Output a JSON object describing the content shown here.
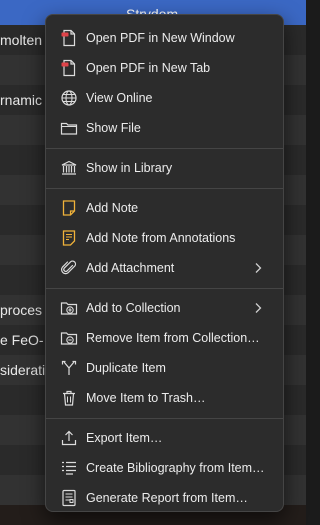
{
  "background": {
    "header_title": "Strydom",
    "rows": [
      "molten s",
      "",
      "rnamic t",
      "",
      "",
      "",
      "",
      "",
      "",
      "proces",
      "e FeO-",
      "siderati",
      "",
      "",
      "",
      "",
      ""
    ]
  },
  "menu": {
    "items": [
      {
        "label": "Open PDF in New Window",
        "icon": "pdf-window-icon"
      },
      {
        "label": "Open PDF in New Tab",
        "icon": "pdf-tab-icon"
      },
      {
        "label": "View Online",
        "icon": "globe-icon"
      },
      {
        "label": "Show File",
        "icon": "folder-icon"
      },
      {
        "label": "Show in Library",
        "icon": "library-icon"
      },
      {
        "label": "Add Note",
        "icon": "note-icon"
      },
      {
        "label": "Add Note from Annotations",
        "icon": "note-annotations-icon"
      },
      {
        "label": "Add Attachment",
        "icon": "paperclip-icon",
        "submenu": true
      },
      {
        "label": "Add to Collection",
        "icon": "add-collection-icon",
        "submenu": true
      },
      {
        "label": "Remove Item from Collection…",
        "icon": "remove-collection-icon"
      },
      {
        "label": "Duplicate Item",
        "icon": "duplicate-icon"
      },
      {
        "label": "Move Item to Trash…",
        "icon": "trash-icon"
      },
      {
        "label": "Export Item…",
        "icon": "export-icon"
      },
      {
        "label": "Create Bibliography from Item…",
        "icon": "bibliography-icon"
      },
      {
        "label": "Generate Report from Item…",
        "icon": "report-icon"
      }
    ]
  },
  "colors": {
    "header": "#3b68c4",
    "menu_bg": "#2c2c2c",
    "pdf_red": "#e0444a",
    "note_yellow": "#f0b23a"
  }
}
